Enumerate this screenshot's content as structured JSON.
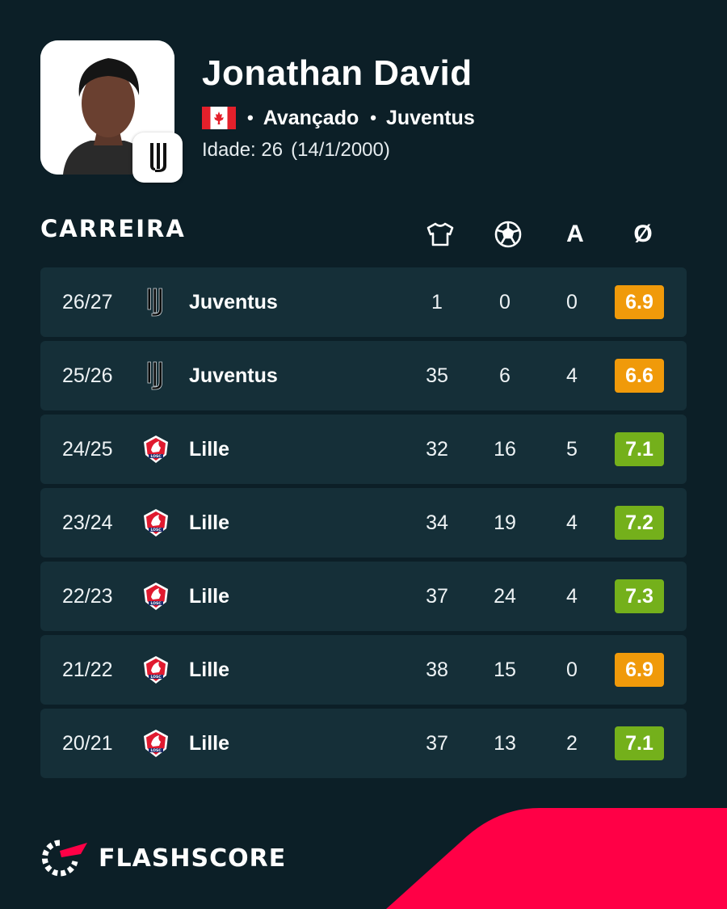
{
  "player": {
    "name": "Jonathan David",
    "position": "Avançado",
    "club": "Juventus",
    "age_label": "Idade: 26",
    "birth_date": "(14/1/2000)"
  },
  "career": {
    "title": "CARREIRA",
    "columns": {
      "appearances_icon": "shirt-icon",
      "goals_icon": "ball-icon",
      "assists": "A",
      "average": "Ø"
    },
    "rows": [
      {
        "season": "26/27",
        "team": "Juventus",
        "crest": "juventus-crest-icon",
        "apps": "1",
        "goals": "0",
        "assists": "0",
        "rating": "6.9",
        "rating_color": "#f09a0a"
      },
      {
        "season": "25/26",
        "team": "Juventus",
        "crest": "juventus-crest-icon",
        "apps": "35",
        "goals": "6",
        "assists": "4",
        "rating": "6.6",
        "rating_color": "#f09a0a"
      },
      {
        "season": "24/25",
        "team": "Lille",
        "crest": "lille-crest-icon",
        "apps": "32",
        "goals": "16",
        "assists": "5",
        "rating": "7.1",
        "rating_color": "#74b01b"
      },
      {
        "season": "23/24",
        "team": "Lille",
        "crest": "lille-crest-icon",
        "apps": "34",
        "goals": "19",
        "assists": "4",
        "rating": "7.2",
        "rating_color": "#74b01b"
      },
      {
        "season": "22/23",
        "team": "Lille",
        "crest": "lille-crest-icon",
        "apps": "37",
        "goals": "24",
        "assists": "4",
        "rating": "7.3",
        "rating_color": "#74b01b"
      },
      {
        "season": "21/22",
        "team": "Lille",
        "crest": "lille-crest-icon",
        "apps": "38",
        "goals": "15",
        "assists": "0",
        "rating": "6.9",
        "rating_color": "#f09a0a"
      },
      {
        "season": "20/21",
        "team": "Lille",
        "crest": "lille-crest-icon",
        "apps": "37",
        "goals": "13",
        "assists": "2",
        "rating": "7.1",
        "rating_color": "#74b01b"
      }
    ]
  },
  "brand": {
    "logo_text": "FLASHSCORE",
    "accent": "#ff0046",
    "background": "#0c1f27",
    "row_background": "#152f38"
  }
}
